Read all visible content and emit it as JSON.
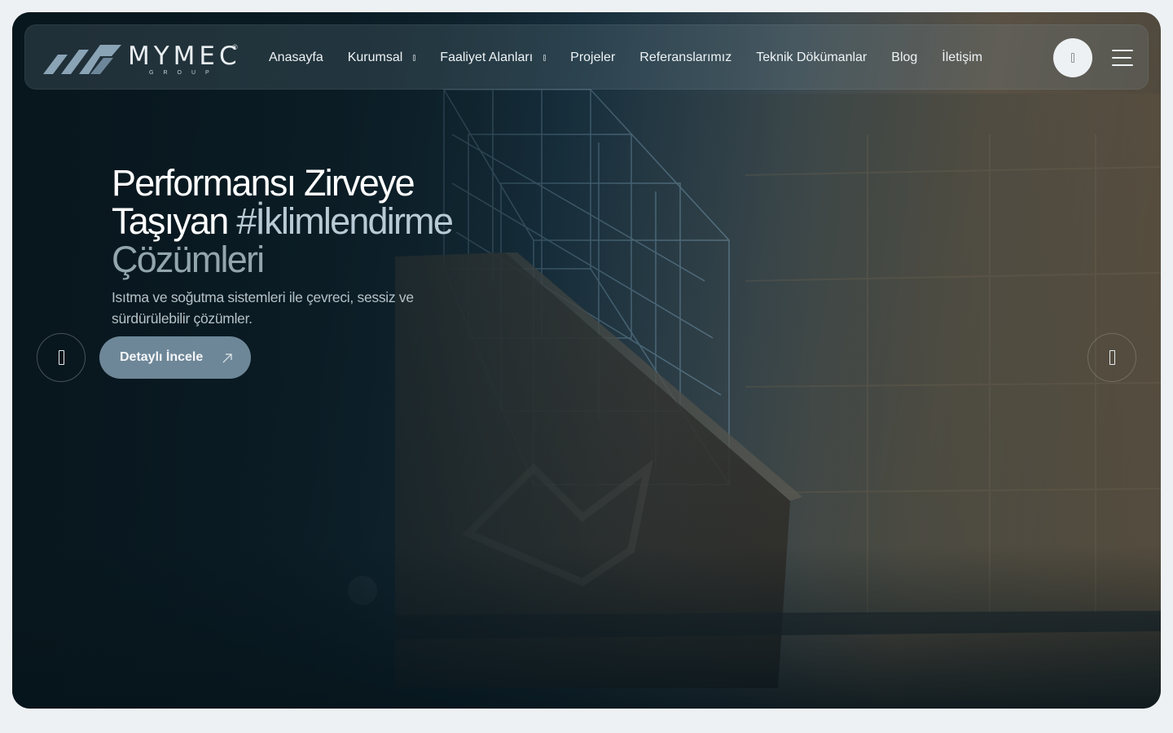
{
  "brand": {
    "name": "MYMEC",
    "reg": "®",
    "sub": "GROUP"
  },
  "nav": {
    "items": [
      {
        "label": "Anasayfa",
        "dropdown": false
      },
      {
        "label": "Kurumsal",
        "dropdown": true
      },
      {
        "label": "Faaliyet Alanları",
        "dropdown": true
      },
      {
        "label": "Projeler",
        "dropdown": false
      },
      {
        "label": "Referanslarımız",
        "dropdown": false
      },
      {
        "label": "Teknik Dökümanlar",
        "dropdown": false
      },
      {
        "label": "Blog",
        "dropdown": false
      },
      {
        "label": "İletişim",
        "dropdown": false
      }
    ],
    "search_icon": "search-icon",
    "menu_icon": "hamburger-icon"
  },
  "hero": {
    "headline_line1": "Performansı Zirveye",
    "headline_line2_a": "Taşıyan ",
    "headline_line2_b": "#İklimlendirme",
    "headline_line3": "Çözümleri",
    "subtitle": "Isıtma ve soğutma sistemleri ile çevreci, sessiz ve sürdürülebilir çözümler.",
    "cta_label": "Detaylı İncele",
    "cta_icon": "arrow-link-icon",
    "prev_icon": "arrow-left-icon",
    "next_icon": "arrow-right-icon"
  },
  "colors": {
    "accent": "#6e8798",
    "page_bg": "#eef1f3",
    "hero_dark": "#0a1a22"
  }
}
